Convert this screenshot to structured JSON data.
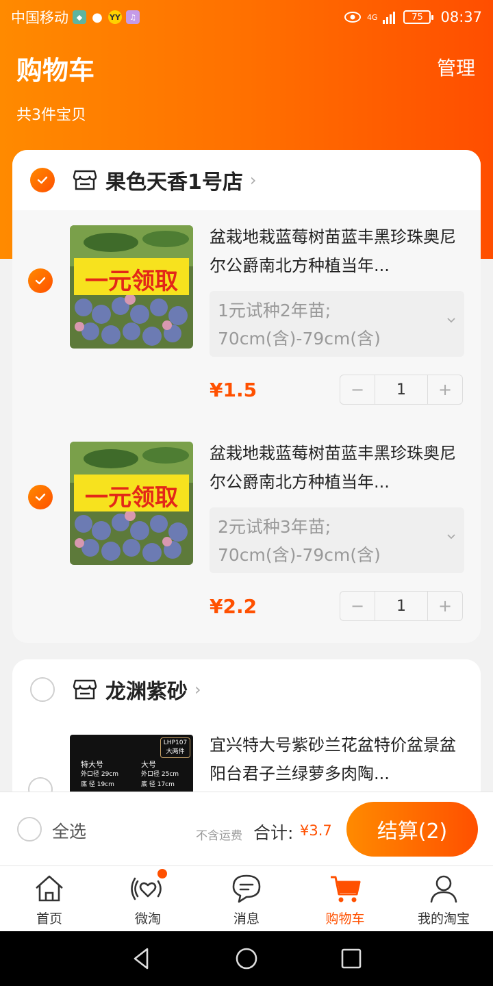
{
  "status_bar": {
    "carrier": "中国移动",
    "battery": "75",
    "time": "08:37",
    "network": "4G"
  },
  "header": {
    "title": "购物车",
    "manage": "管理",
    "subtitle": "共3件宝贝"
  },
  "shops": [
    {
      "name": "果色天香1号店",
      "checked": true,
      "items": [
        {
          "title": "盆栽地栽蓝莓树苗蓝丰黑珍珠奥尼尔公爵南北方种植当年...",
          "thumb_text": "一元领取",
          "sku_line1": "1元试种2年苗;",
          "sku_line2": "70cm(含)-79cm(含)",
          "price": "¥1.5",
          "quantity": "1",
          "checked": true
        },
        {
          "title": "盆栽地栽蓝莓树苗蓝丰黑珍珠奥尼尔公爵南北方种植当年...",
          "thumb_text": "一元领取",
          "sku_line1": "2元试种3年苗;",
          "sku_line2": "70cm(含)-79cm(含)",
          "price": "¥2.2",
          "quantity": "1",
          "checked": true
        }
      ]
    },
    {
      "name": "龙渊紫砂",
      "checked": false,
      "items": [
        {
          "title": "宜兴特大号紫砂兰花盆特价盆景盆阳台君子兰绿萝多肉陶...",
          "thumb_badge": "LHP107",
          "thumb_badge2": "大两件",
          "thumb_col1_title": "特大号",
          "thumb_col1_l1": "外口径 29cm",
          "thumb_col1_l2": "底  径 19cm",
          "thumb_col2_title": "大号",
          "thumb_col2_l1": "外口径 25cm",
          "thumb_col2_l2": "底  径 17cm",
          "checked": false
        }
      ]
    }
  ],
  "checkout": {
    "select_all": "全选",
    "freight_note": "不含运费",
    "total_label": "合计:",
    "total_value": "¥3.7",
    "pay_button": "结算(2)"
  },
  "tabs": [
    {
      "label": "首页",
      "icon": "home-icon"
    },
    {
      "label": "微淘",
      "icon": "weitao-icon"
    },
    {
      "label": "消息",
      "icon": "message-icon"
    },
    {
      "label": "购物车",
      "icon": "cart-icon",
      "active": true
    },
    {
      "label": "我的淘宝",
      "icon": "profile-icon"
    }
  ],
  "colors": {
    "accent": "#ff5000",
    "gradient_start": "#ff8a00"
  }
}
